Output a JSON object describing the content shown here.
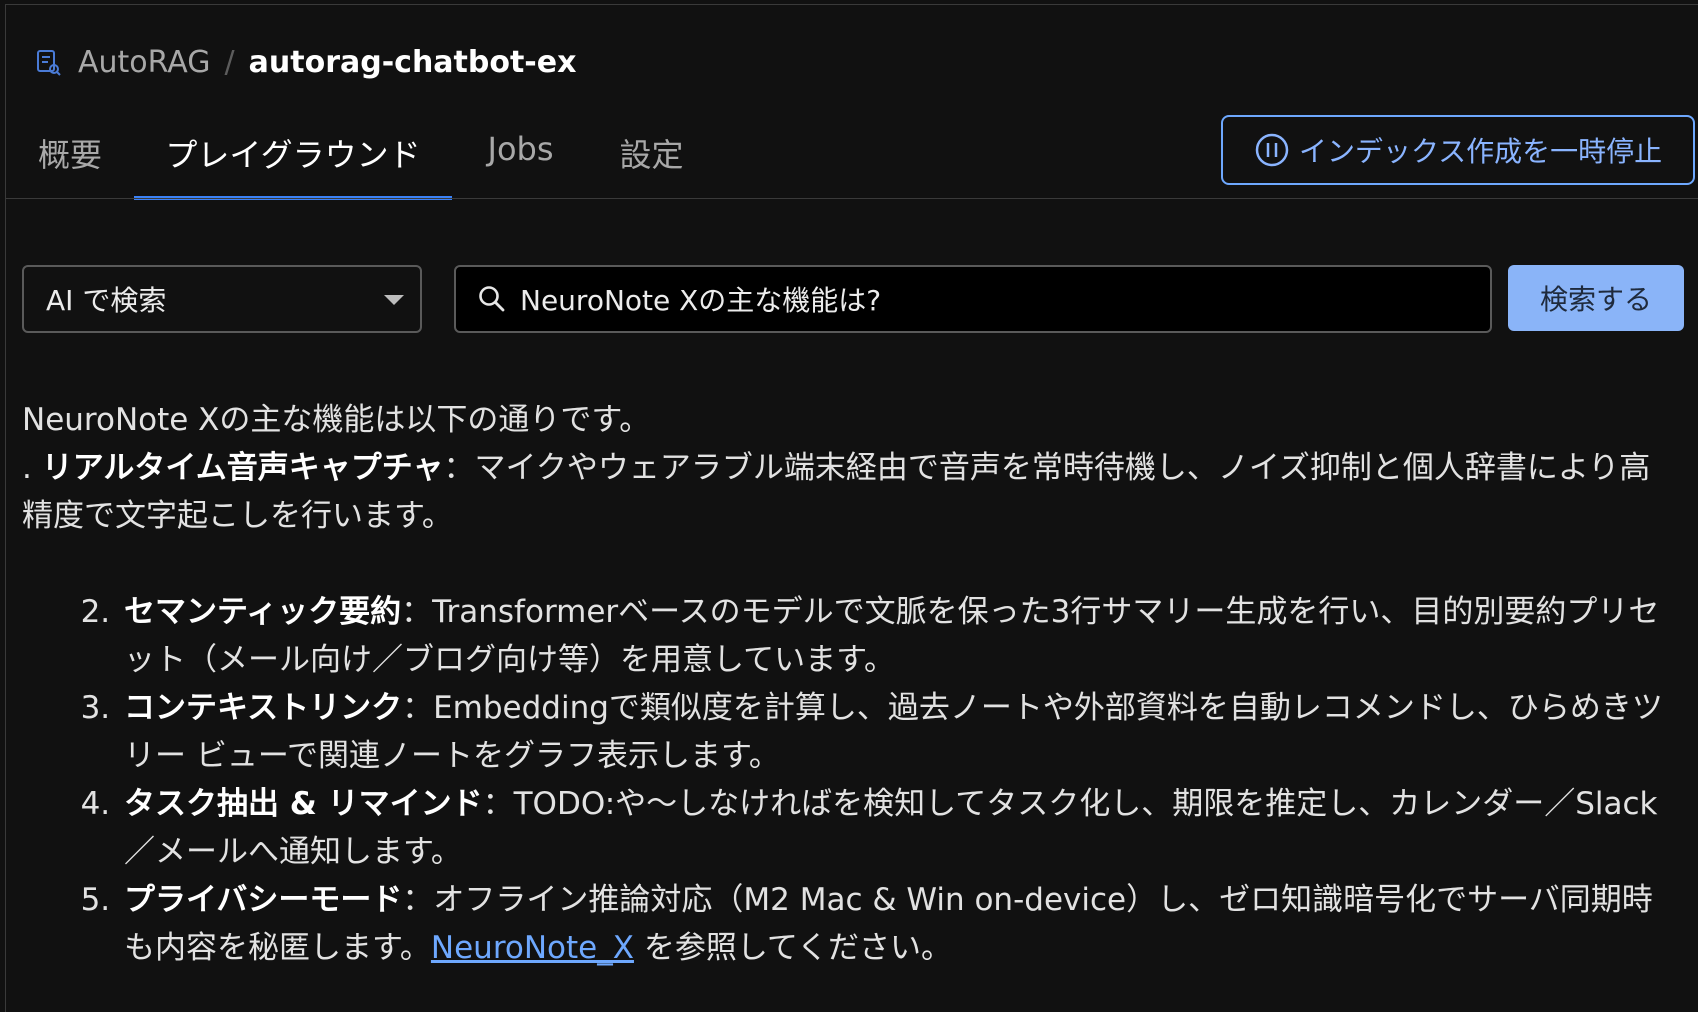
{
  "breadcrumb": {
    "root": "AutoRAG",
    "separator": "/",
    "current": "autorag-chatbot-ex"
  },
  "tabs": [
    {
      "label": "概要",
      "active": false
    },
    {
      "label": "プレイグラウンド",
      "active": true
    },
    {
      "label": "Jobs",
      "active": false
    },
    {
      "label": "設定",
      "active": false
    }
  ],
  "pause_button": {
    "label": "インデックス作成を一時停止",
    "icon": "pause-circle-icon"
  },
  "search": {
    "mode": "AI で検索",
    "query": "NeuroNote Xの主な機能は?",
    "submit_label": "検索する",
    "icon": "search-icon"
  },
  "answer": {
    "intro": "NeuroNote Xの主な機能は以下の通りです。",
    "first_item": {
      "prefix": ". ",
      "title": "リアルタイム音声キャプチャ",
      "separator": "：",
      "body": "マイクやウェアラブル端末経由で音声を常時待機し、ノイズ抑制と個人辞書により高精度で文字起こしを行います。"
    },
    "items": [
      {
        "title": "セマンティック要約",
        "separator": "：",
        "body": "Transformerベースのモデルで文脈を保った3行サマリー生成を行い、目的別要約プリセット（メール向け／ブログ向け等）を用意しています。"
      },
      {
        "title": "コンテキストリンク",
        "separator": "：",
        "body": "Embeddingで類似度を計算し、過去ノートや外部資料を自動レコメンドし、ひらめきツリー ビューで関連ノートをグラフ表示します。"
      },
      {
        "title": "タスク抽出 & リマインド",
        "separator": "：",
        "body": "TODO:や〜しなければを検知してタスク化し、期限を推定し、カレンダー／Slack／メールへ通知します。"
      },
      {
        "title": "プライバシーモード",
        "separator": "：",
        "body": "オフライン推論対応（M2 Mac & Win on-device）し、ゼロ知識暗号化でサーバ同期時も内容を秘匿します。",
        "link": "NeuroNote_X",
        "suffix": " を参照してください。"
      }
    ]
  },
  "colors": {
    "background": "#111111",
    "accent": "#3b82f6",
    "link": "#6ea8fe",
    "primary_button": "#8ab4f8"
  }
}
